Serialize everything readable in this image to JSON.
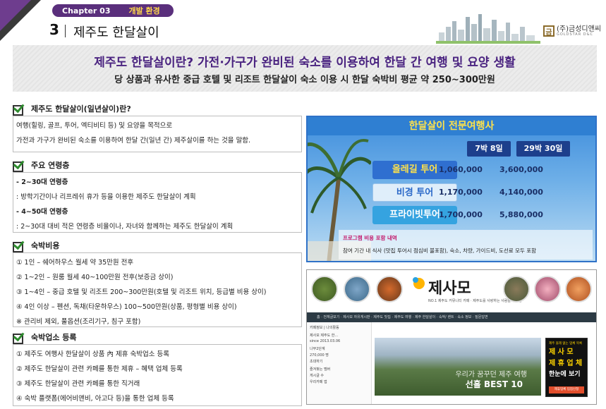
{
  "header": {
    "chapter": "Chapter 03",
    "chapter_sub": "개발 환경",
    "section_number": "3",
    "section_title": "제주도 한달살이",
    "logo_mark": "금",
    "logo_ko": "(주)금성디앤씨",
    "logo_en": "GOLDSTAR D&C"
  },
  "banner": {
    "headline": "제주도 한달살이란? 가전·가구가 완비된 숙소를 이용하여 한달 간 여행 및 요양 생활",
    "subline": "당 상품과 유사한 중급 호텔 및 리조트 한달살이 숙소 이용 시 한달 숙박비 평균 약 250~300만원"
  },
  "sections": [
    {
      "heading": "제주도 한달살이(일년살이)란?",
      "lines": [
        {
          "text": "여행(힐링, 골프, 투어, 엑티비티 등) 및 요양을 목적으로",
          "bold": false
        },
        {
          "text": "가전과 가구가 완비된 숙소를 이용하여 한달 간(일년 간) 제주살이를 하는 것을 말함.",
          "bold": false
        }
      ]
    },
    {
      "heading": "주요 연령층",
      "lines": [
        {
          "text": "- 2~30대 연령층",
          "bold": true
        },
        {
          "text": "  : 방학기간이나 리프레쉬 휴가 등을 이용한 제주도 한달살이 계획",
          "bold": false
        },
        {
          "text": "- 4~50대 연령층",
          "bold": true
        },
        {
          "text": "  : 2~30대 대비 적은 연령층 비율이나, 자녀와 함께하는 제주도 한달살이 계획",
          "bold": false
        }
      ]
    },
    {
      "heading": "숙박비용",
      "lines": [
        {
          "text": "① 1인 – 쉐어하우스 월세 약 35만원 전후",
          "bold": false
        },
        {
          "text": "② 1~2인 – 원룸 월세 40~100만원 전후(보증금 상이)",
          "bold": false
        },
        {
          "text": "③ 1~4인 – 중급 호텔 및 리조트 200~300만원(호텔 및 리조트 위치, 등급별 비용 상이)",
          "bold": false
        },
        {
          "text": "④ 4인 이상 – 펜션, 독채(타운하우스) 100~500만원(상품, 평형별 비용 상이)",
          "bold": false
        },
        {
          "text": "※ 관리비 제외, 풀옵션(조리기구, 침구 포함)",
          "bold": false
        }
      ]
    },
    {
      "heading": "숙박업소 등록",
      "lines": [
        {
          "text": "① 제주도 여행사 한달살이 상품 內 제휴 숙박업소 등록",
          "bold": false
        },
        {
          "text": "② 제주도 한달살이 관련 카페를 통한 제휴 – 혜택 업체 등록",
          "bold": false
        },
        {
          "text": "③ 제주도 한달살이 관련 카페를 통한 직거래",
          "bold": false
        },
        {
          "text": "④ 숙박 플랫폼(에어비앤비, 아고다 등)을 통한 업체 등록",
          "bold": false
        }
      ]
    }
  ],
  "price_table": {
    "title": "한달살이 전문여행사",
    "columns": [
      "7박 8일",
      "29박 30일"
    ],
    "rows": [
      {
        "tour": "올레길 투어",
        "p1": "1,060,000",
        "p2": "3,600,000"
      },
      {
        "tour": "비경 투어",
        "p1": "1,170,000",
        "p2": "4,140,000"
      },
      {
        "tour": "프라이빗투어",
        "p1": "1,700,000",
        "p2": "5,880,000"
      }
    ],
    "included_label": "프로그램 비용 포함 내역",
    "included_text": "참여 기간 내 식사 (맛집 투어시 점심비 불포함), 숙소, 차량, 가이드비, 도선료 모두 포함"
  },
  "cafe": {
    "logo": "제사모",
    "logo_sub": "NO.1 제주도 커뮤니티 카페 · 제주도를 사랑하는 사람들의 모임",
    "nav": "홈 · 전체글보기 · 제사모 자유게시판 · 제주도 맛집 · 제주도 여행 · 제주 한달살이 · 숙박/ 렌트 · 숙소 정보 · 질문답변",
    "side_lines": [
      "카페정보 | 나의활동",
      "제사모 제주도 한...",
      "since 2013.03.06",
      "나무2단계",
      "270,000 명",
      "초대하기",
      "즐겨찾는 멤버",
      "게시글 수",
      "우리카페 앱"
    ],
    "photo_line1": "우리가 꿈꾸던 제주 여행",
    "photo_line2": "선흘 BEST 10",
    "ad_small": "제주 올레 없는 업체 목록",
    "ad_big1": "제 사 모",
    "ad_big2": "제 휴 업 체",
    "ad_white": "한눈에 보기",
    "ad_button": "제휴업체 입점신청"
  },
  "colors": {
    "accent_purple": "#4a2380",
    "chapter_pill": "#5a2f7c",
    "price_blue": "#2f7fd2",
    "check_green": "#2e8b2e"
  }
}
